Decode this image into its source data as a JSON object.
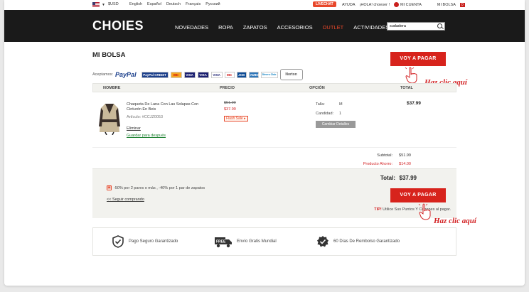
{
  "topbar": {
    "currency": "$USD",
    "languages": [
      "English",
      "Español",
      "Deutsch",
      "Français",
      "Pусский"
    ],
    "livechat": "LIVECHAT",
    "ayuda": "AYUDA",
    "greeting": "¡HOLA! choeser !",
    "account": "MI CUENTA",
    "bag": "MI BOLSA",
    "bag_count": "0"
  },
  "header": {
    "logo": "CHOIES",
    "nav": [
      "NOVEDADES",
      "ROPA",
      "ZAPATOS",
      "ACCESORIOS",
      "OUTLET",
      "ACTIVIDADES"
    ],
    "search_value": "sudadera"
  },
  "cart": {
    "title": "MI BOLSA",
    "accept_label": "Aceptamos:",
    "paypal": "PayPal",
    "payment_methods": [
      "PayPal CREDIT",
      "MC",
      "VISA",
      "VISA",
      "VISA",
      "MC",
      "JCB",
      "AMEX",
      "Diners Club",
      "Norton"
    ],
    "pay_button": "VOY A PAGAR",
    "click_hint": "Haz clic aquí",
    "columns": [
      "NOMBRE",
      "PRECIO",
      "OPCIÓN",
      "TOTAL"
    ],
    "item": {
      "name": "Chaqueta De Lana Con Las Solapas Con Cinturón En Beis",
      "sku": "Artículo: #CCJZ0053",
      "remove": "Eliminar",
      "save_later": "Guardar para después",
      "old_price": "$51.99",
      "new_price": "$37.99",
      "flash": "Flash Sale ▸",
      "size_label": "Talla:",
      "size_value": "M",
      "qty_label": "Candidad:",
      "qty_value": "1",
      "change": "Cambiar Detalles",
      "total": "$37.99"
    },
    "subtotal_label": "Subtotal:",
    "subtotal_value": "$51.99",
    "savings_label": "Producto Ahorro:",
    "savings_value": "$14.00",
    "total_label": "Total:",
    "total_value": "$37.99",
    "promo": "-50% por 2 pares o más , -40% por 1 par de zapatos",
    "continue": "<< Seguir comprando",
    "tip_label": "TIP!",
    "tip_text": " Utilice Sus Puntos Y Cupones al pagar."
  },
  "features": [
    "Pago Seguro Garantizado",
    "Envío Gratis Mundial",
    "60 Días De Rembolso Garantizado"
  ],
  "colors": {
    "accent": "#d7231c",
    "header": "#1a1a1a",
    "savings": "#d32325",
    "save_link": "#1a7f2e"
  }
}
